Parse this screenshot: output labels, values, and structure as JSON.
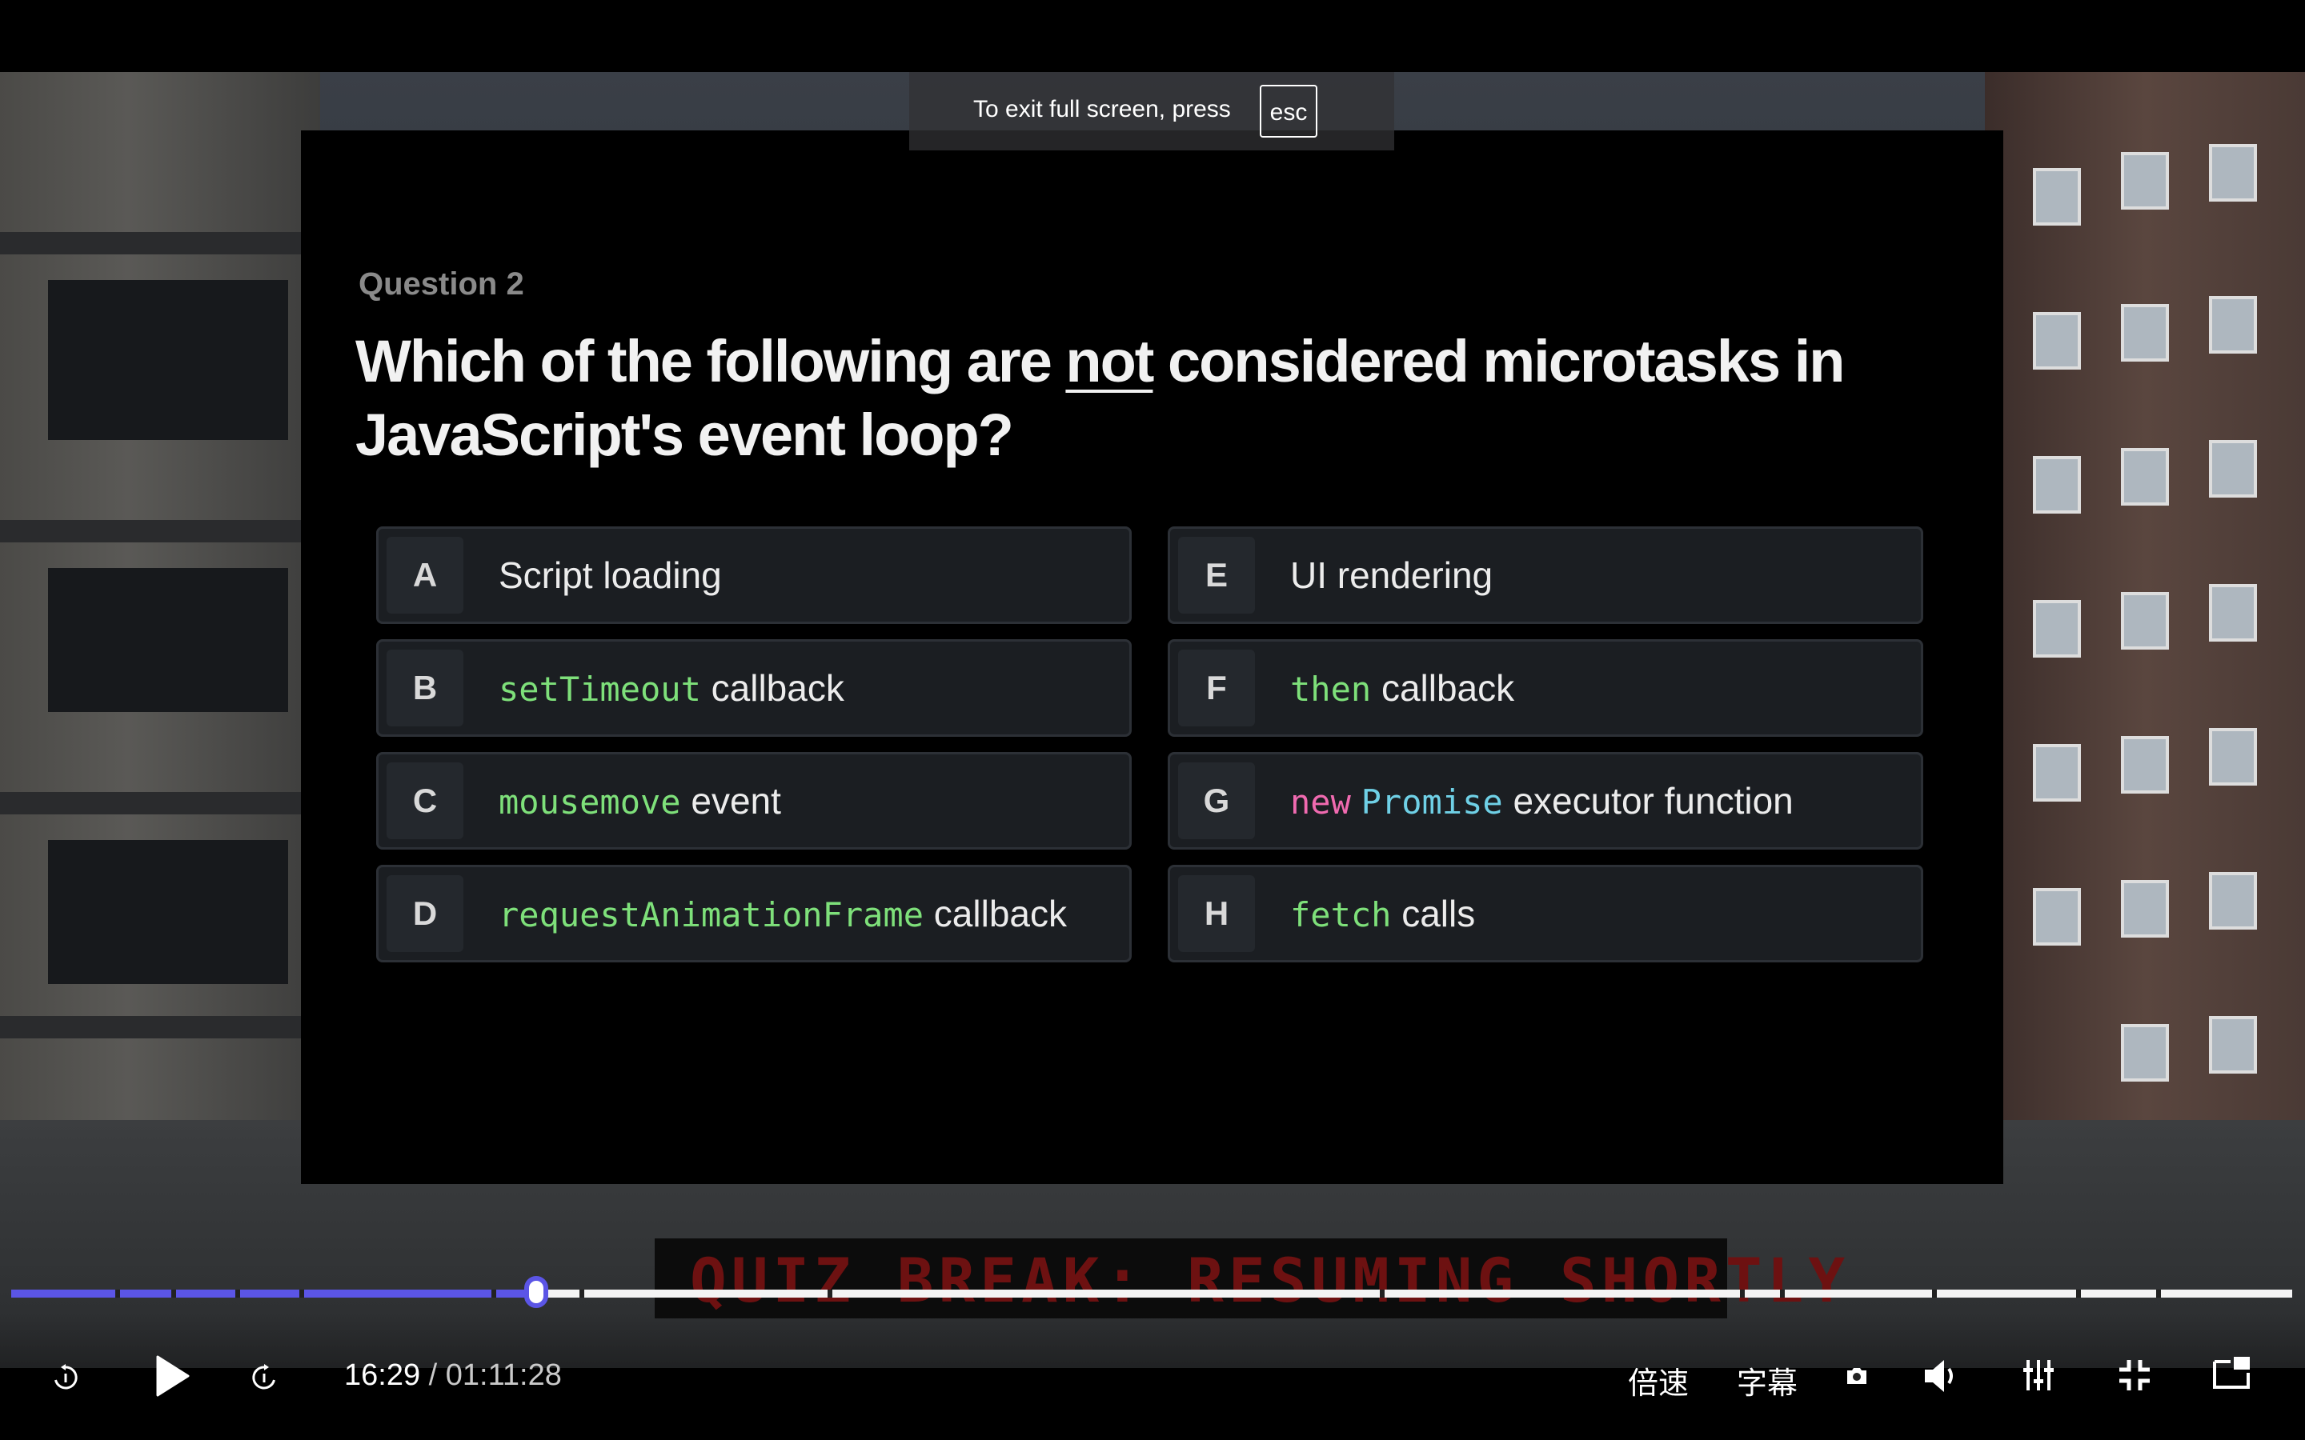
{
  "notice": {
    "message": "To exit full screen, press",
    "key": "esc"
  },
  "slide": {
    "question_label": "Question 2",
    "title_part1": "Which of the following are ",
    "title_emphasis": "not",
    "title_part2": " considered microtasks in JavaScript's event loop?",
    "options": [
      {
        "letter": "A",
        "code": "",
        "text": "Script loading"
      },
      {
        "letter": "B",
        "code": "setTimeout",
        "text": "callback"
      },
      {
        "letter": "C",
        "code": "mousemove",
        "text": "event"
      },
      {
        "letter": "D",
        "code": "requestAnimationFrame",
        "text": "callback"
      },
      {
        "letter": "E",
        "code": "",
        "text": "UI rendering"
      },
      {
        "letter": "F",
        "code": "then",
        "text": "callback"
      },
      {
        "letter": "G",
        "code_keyword": "new",
        "code": "Promise",
        "text": "executor function"
      },
      {
        "letter": "H",
        "code": "fetch",
        "text": "calls"
      }
    ]
  },
  "ticker": {
    "text": "QUIZ BREAK: RESUMING SHORTLY"
  },
  "player": {
    "current_time": "16:29",
    "separator": "/",
    "duration": "01:11:28",
    "progress_fraction": 0.23,
    "speed_label": "倍速",
    "subtitle_label": "字幕",
    "accent_color": "#5b55e6"
  },
  "colors": {
    "code_green": "#7ee07a",
    "code_pink": "#f06ab0",
    "code_cyan": "#6fd0e6"
  }
}
